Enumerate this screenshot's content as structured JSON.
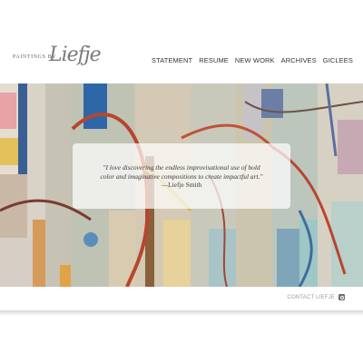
{
  "header": {
    "logo_small": "PAINTINGS BY",
    "logo_script": "Liefje"
  },
  "nav": {
    "items": [
      "STATEMENT",
      "RESUME",
      "NEW WORK",
      "ARCHIVES",
      "GICLEES"
    ]
  },
  "hero": {
    "quote_line1": "\"I love discovering the endless improvisational use of bold",
    "quote_line2": "color and imaginative compositions to create impactful art.\"",
    "author": "—Liefje Smith"
  },
  "footer": {
    "contact_label": "CONTACT LIEFJE",
    "social_icon": "instagram-icon"
  },
  "colors": {
    "accent_red": "#b8452e",
    "accent_blue": "#2f5f9c",
    "text": "#333333"
  }
}
